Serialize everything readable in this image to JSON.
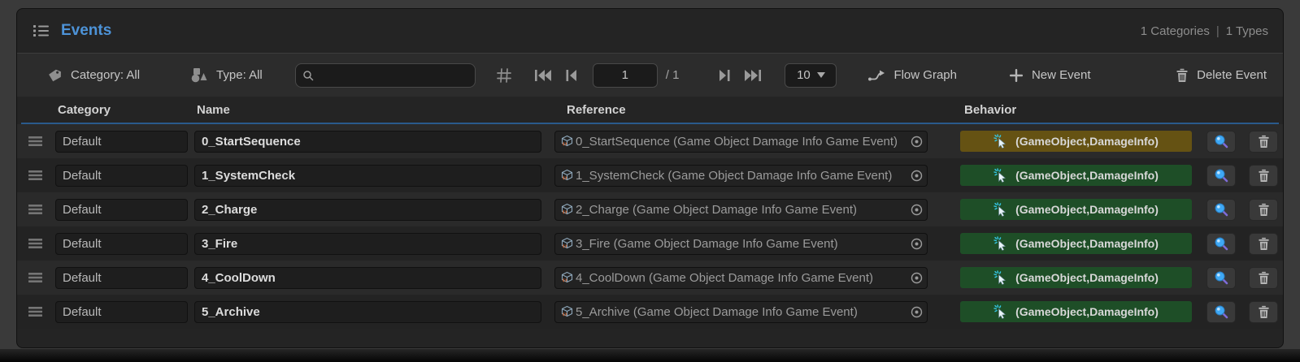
{
  "header": {
    "title": "Events",
    "categories_summary": "1 Categories",
    "separator": "|",
    "types_summary": "1 Types"
  },
  "toolbar": {
    "category_filter": "Category: All",
    "type_filter": "Type: All",
    "search_placeholder": "",
    "search_value": "",
    "page": {
      "current": "1",
      "total": "/ 1"
    },
    "page_size": "10",
    "flow_graph_label": "Flow Graph",
    "new_event_label": "New Event",
    "delete_event_label": "Delete Event"
  },
  "table": {
    "columns": [
      "Category",
      "Name",
      "Reference",
      "Behavior"
    ],
    "rows": [
      {
        "category": "Default",
        "name": "0_StartSequence",
        "reference": "0_StartSequence (Game Object Damage Info Game Event)",
        "behavior": "(GameObject,DamageInfo)",
        "behavior_color": "#655213"
      },
      {
        "category": "Default",
        "name": "1_SystemCheck",
        "reference": "1_SystemCheck (Game Object Damage Info Game Event)",
        "behavior": "(GameObject,DamageInfo)",
        "behavior_color": "#1e4e27"
      },
      {
        "category": "Default",
        "name": "2_Charge",
        "reference": "2_Charge (Game Object Damage Info Game Event)",
        "behavior": "(GameObject,DamageInfo)",
        "behavior_color": "#1e4e27"
      },
      {
        "category": "Default",
        "name": "3_Fire",
        "reference": "3_Fire (Game Object Damage Info Game Event)",
        "behavior": "(GameObject,DamageInfo)",
        "behavior_color": "#1e4e27"
      },
      {
        "category": "Default",
        "name": "4_CoolDown",
        "reference": "4_CoolDown (Game Object Damage Info Game Event)",
        "behavior": "(GameObject,DamageInfo)",
        "behavior_color": "#1e4e27"
      },
      {
        "category": "Default",
        "name": "5_Archive",
        "reference": "5_Archive (Game Object Damage Info Game Event)",
        "behavior": "(GameObject,DamageInfo)",
        "behavior_color": "#1e4e27"
      }
    ]
  },
  "colors": {
    "accent_blue": "#4d93d8",
    "header_line": "#2a5a8c",
    "badge_olive": "#655213",
    "badge_green": "#1e4e27",
    "panel_bg": "#242424",
    "toolbar_bg": "#2c2c2c"
  },
  "icons": {
    "panel": "list-icon",
    "category": "tag-icon",
    "type": "shapes-icon",
    "search": "search-icon",
    "grid": "grid-icon",
    "flow": "flow-branch-icon",
    "new": "plus-icon",
    "delete": "trash-icon",
    "reference_object": "scriptable-object-icon",
    "reference_picker": "object-picker-icon",
    "behavior": "cursor-click-icon",
    "inspect": "magnifier-icon"
  }
}
